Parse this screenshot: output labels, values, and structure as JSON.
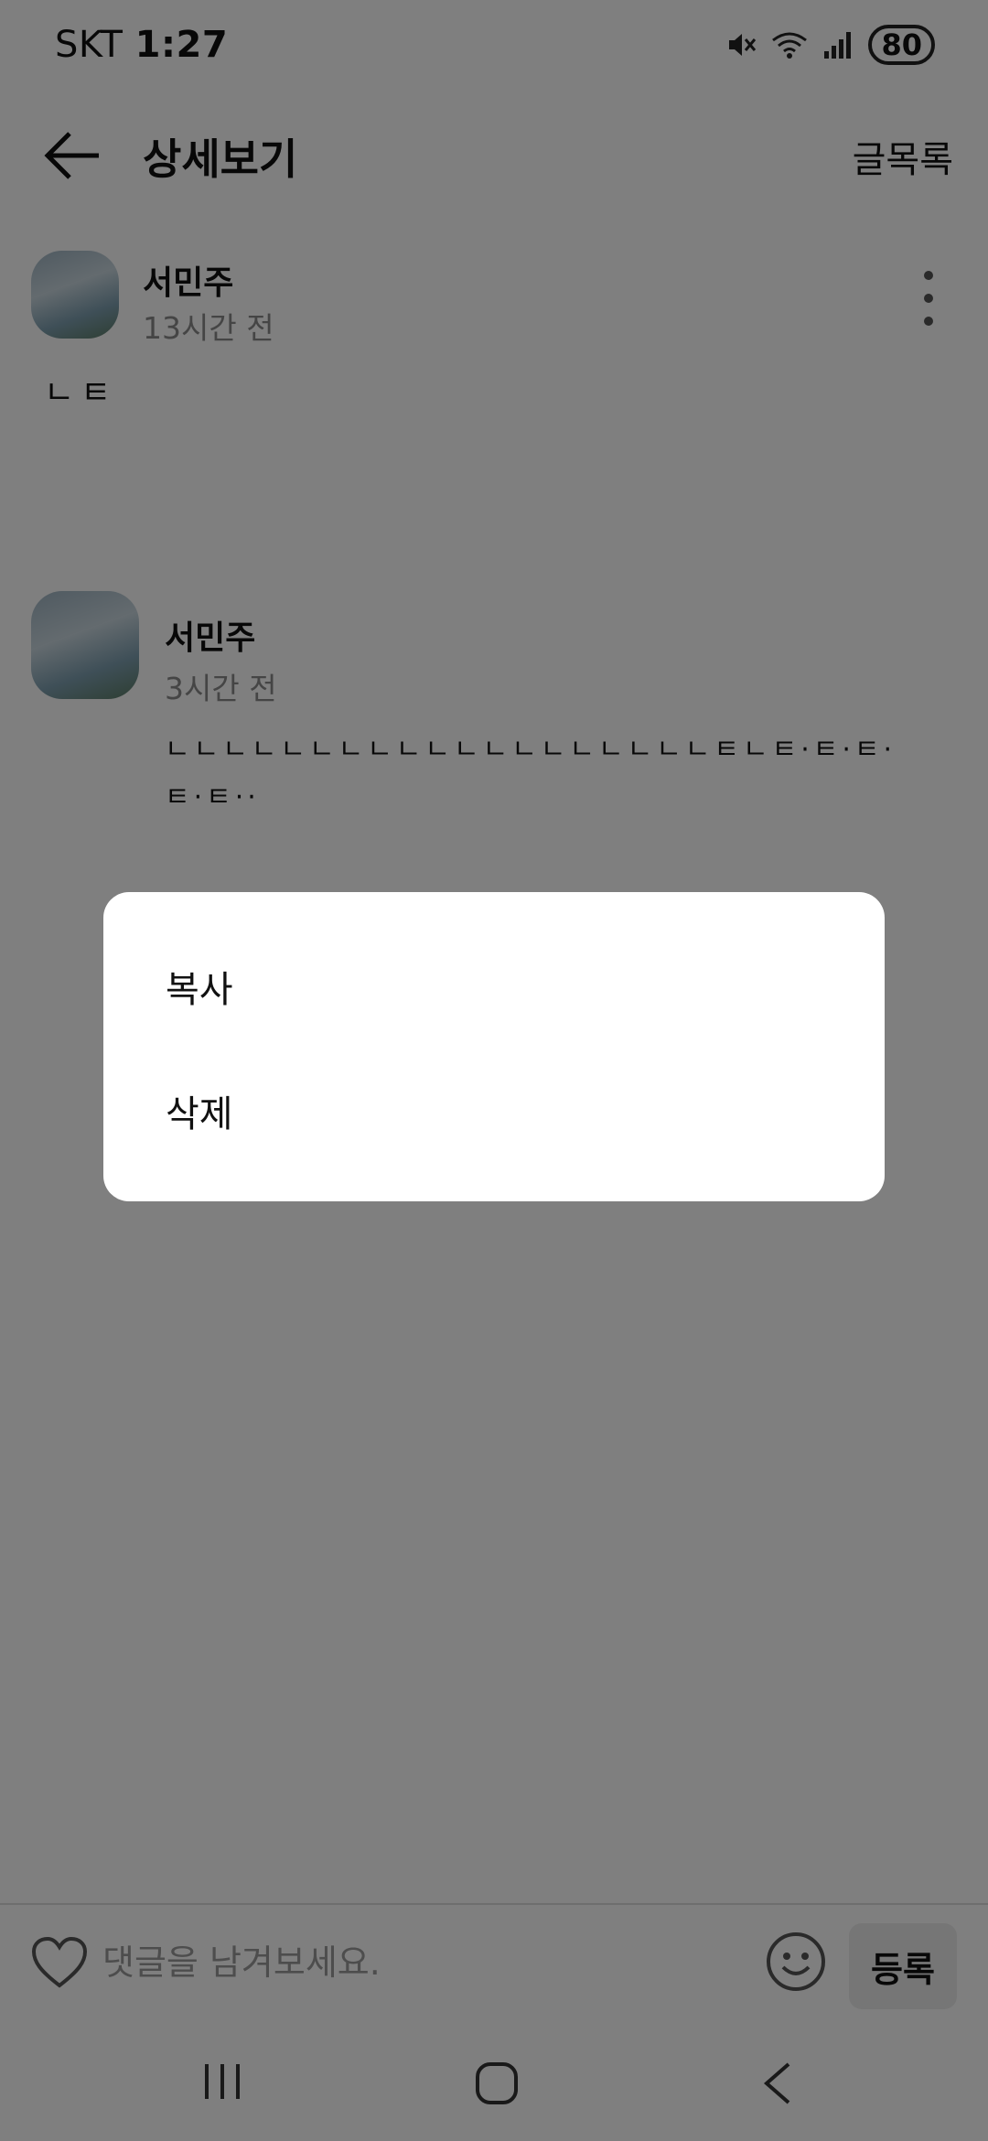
{
  "status_bar": {
    "carrier": "SKT",
    "time": "1:27",
    "battery": "80",
    "icons": [
      "mute-icon",
      "wifi-icon",
      "signal-icon",
      "battery-icon"
    ]
  },
  "header": {
    "title": "상세보기",
    "list_link": "글목록"
  },
  "posts": [
    {
      "username": "서민주",
      "time_ago": "13시간 전",
      "content": "ㄴㅌ"
    },
    {
      "username": "서민주",
      "time_ago": "3시간 전",
      "content_line1": "ㄴㄴㄴㄴㄴㄴㄴㄴㄴㄴㄴㄴㄴㄴㄴㄴㄴㄴㄴㅌㄴㅌ·ㅌ·ㅌ·",
      "content_line2": "ㅌ·ㅌ··"
    }
  ],
  "comment_bar": {
    "placeholder": "댓글을 남겨보세요.",
    "submit_label": "등록"
  },
  "dialog": {
    "items": [
      {
        "label": "복사"
      },
      {
        "label": "삭제"
      }
    ]
  }
}
